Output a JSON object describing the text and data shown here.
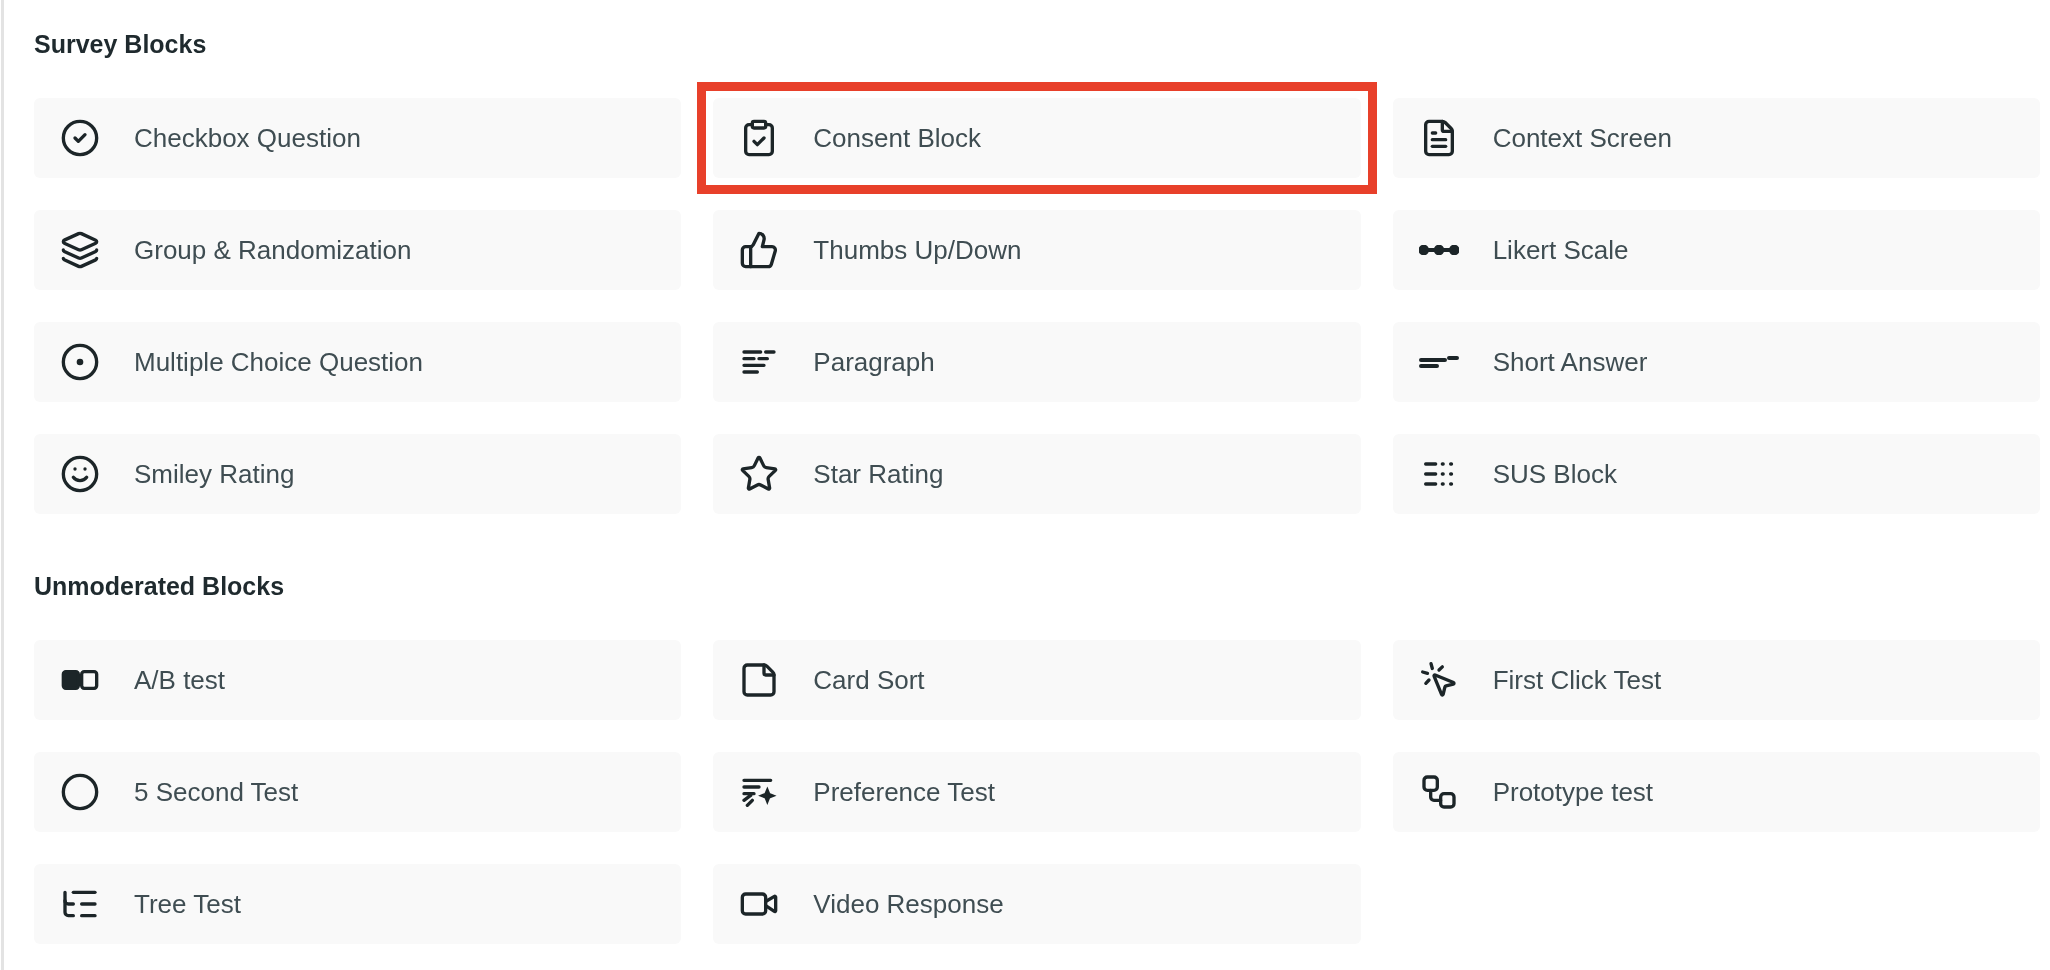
{
  "sections": [
    {
      "title": "Survey Blocks",
      "items": [
        {
          "label": "Checkbox Question",
          "highlighted": false
        },
        {
          "label": "Consent Block",
          "highlighted": true
        },
        {
          "label": "Context Screen",
          "highlighted": false
        },
        {
          "label": "Group & Randomization",
          "highlighted": false
        },
        {
          "label": "Thumbs Up/Down",
          "highlighted": false
        },
        {
          "label": "Likert Scale",
          "highlighted": false
        },
        {
          "label": "Multiple Choice Question",
          "highlighted": false
        },
        {
          "label": "Paragraph",
          "highlighted": false
        },
        {
          "label": "Short Answer",
          "highlighted": false
        },
        {
          "label": "Smiley Rating",
          "highlighted": false
        },
        {
          "label": "Star Rating",
          "highlighted": false
        },
        {
          "label": "SUS Block",
          "highlighted": false
        }
      ]
    },
    {
      "title": "Unmoderated Blocks",
      "items": [
        {
          "label": "A/B test",
          "highlighted": false
        },
        {
          "label": "Card Sort",
          "highlighted": false
        },
        {
          "label": "First Click Test",
          "highlighted": false
        },
        {
          "label": "5 Second Test",
          "highlighted": false
        },
        {
          "label": "Preference Test",
          "highlighted": false
        },
        {
          "label": "Prototype test",
          "highlighted": false
        },
        {
          "label": "Tree Test",
          "highlighted": false
        },
        {
          "label": "Video Response",
          "highlighted": false
        }
      ]
    }
  ]
}
